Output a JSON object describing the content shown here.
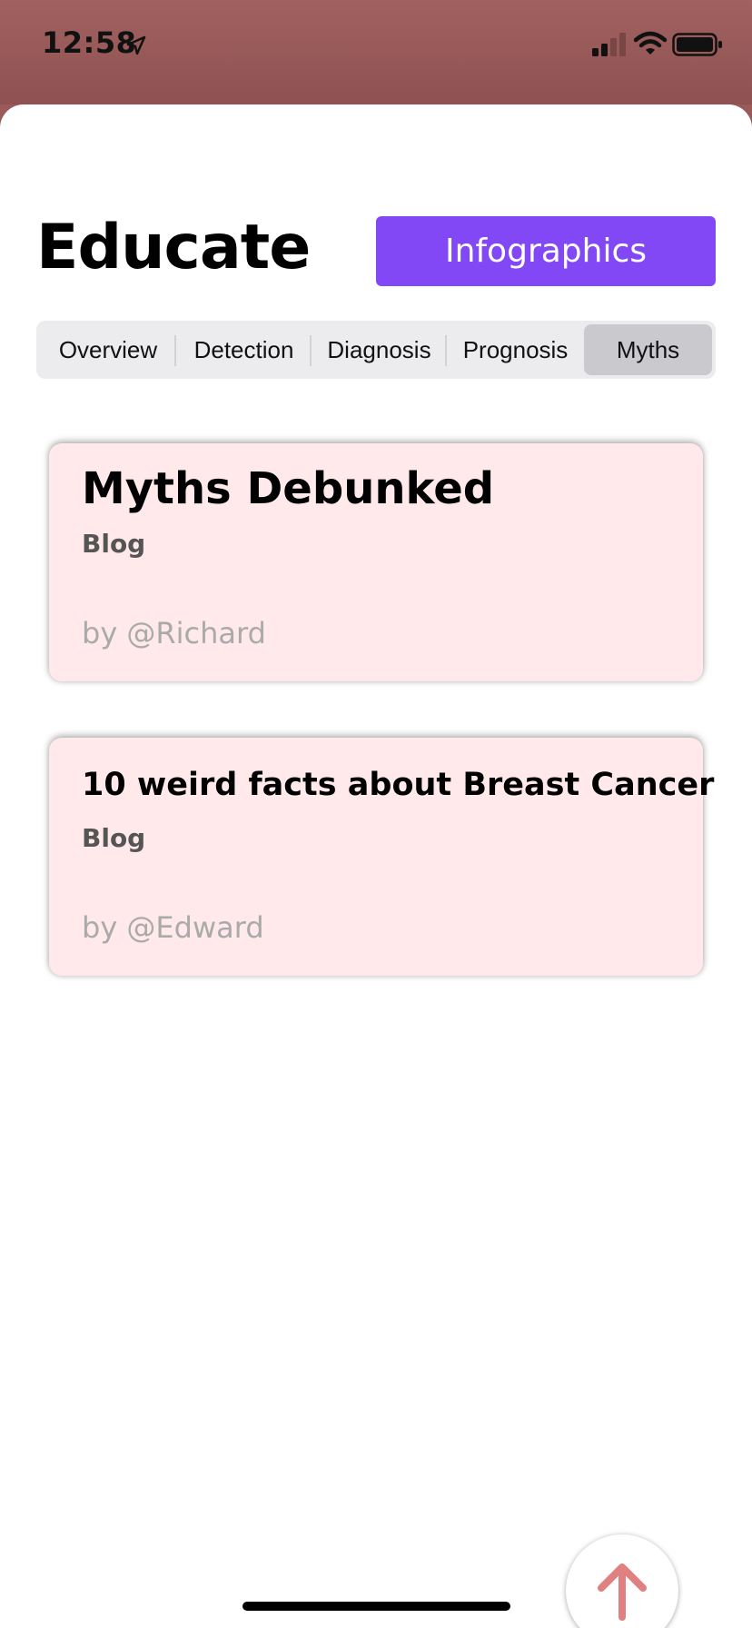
{
  "status_bar": {
    "time": "12:58",
    "icons": [
      "location-arrow-icon",
      "cellular-signal-icon",
      "wifi-icon",
      "battery-icon"
    ]
  },
  "header": {
    "title": "Educate",
    "infographics_label": "Infographics"
  },
  "tabs": [
    {
      "label": "Overview",
      "selected": false
    },
    {
      "label": "Detection",
      "selected": false
    },
    {
      "label": "Diagnosis",
      "selected": false
    },
    {
      "label": "Prognosis",
      "selected": false
    },
    {
      "label": "Myths",
      "selected": true
    }
  ],
  "cards": [
    {
      "title": "Myths Debunked",
      "type": "Blog",
      "author": "by @Richard"
    },
    {
      "title": "10 weird facts about Breast Cancer",
      "type": "Blog",
      "author": "by @Edward"
    }
  ],
  "colors": {
    "accent": "#8348f5",
    "card_background": "#ffe9ea",
    "status_bar": "#9b5a5a",
    "scroll_arrow": "#e08080"
  },
  "scroll_top_icon": "arrow-up-icon"
}
